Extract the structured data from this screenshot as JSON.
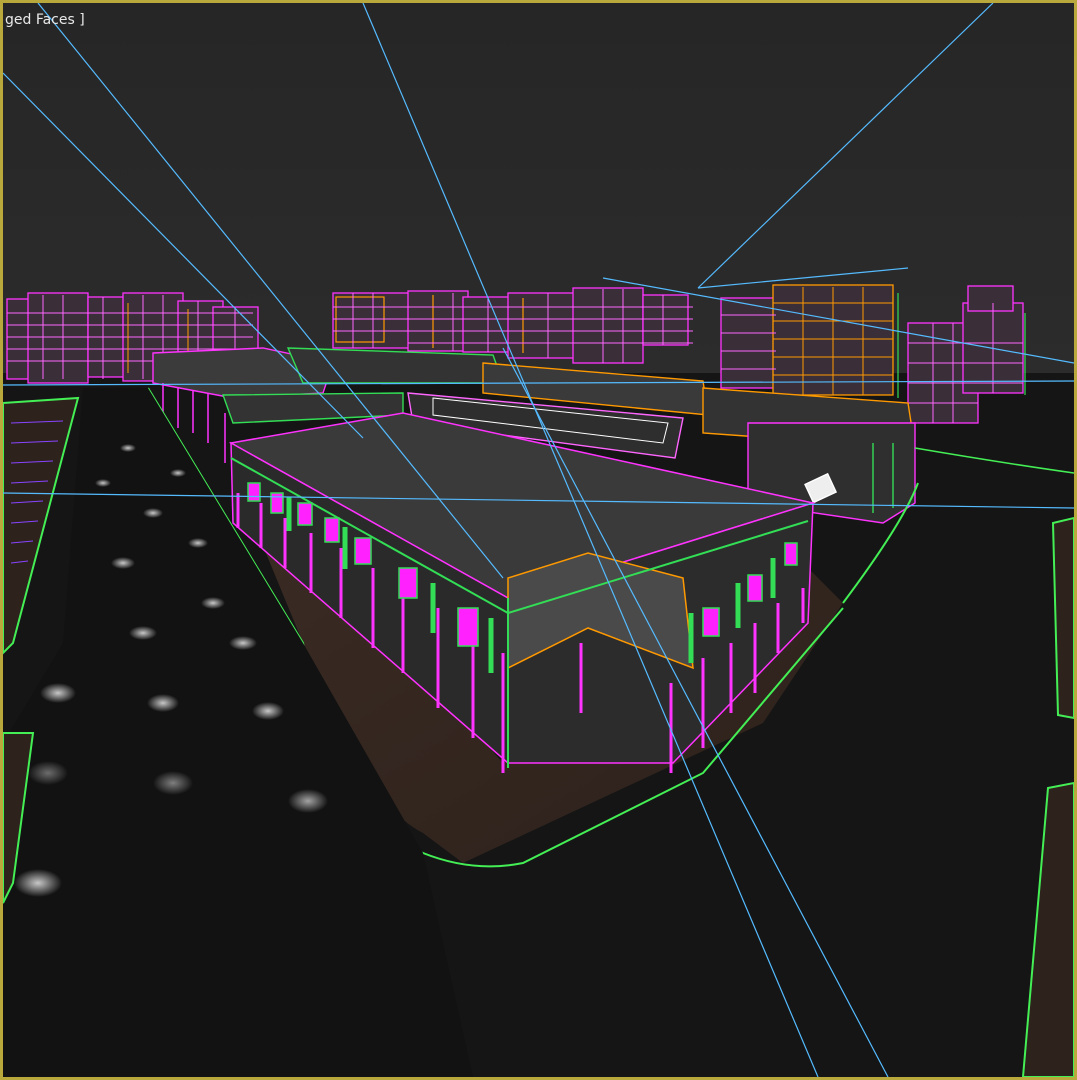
{
  "viewport": {
    "label": "ged Faces ]",
    "border_color": "#b9a83c",
    "shading_mode": "edged-faces"
  },
  "scene": {
    "wire_colors": {
      "building": "#ff33ff",
      "trim": "#33dd55",
      "accent": "#ff9900",
      "road_edge": "#44ee55",
      "camera_line": "#55bbff"
    },
    "background_color": "#262626",
    "ground_color": "#141414",
    "paving_color": "#3a2a22"
  }
}
